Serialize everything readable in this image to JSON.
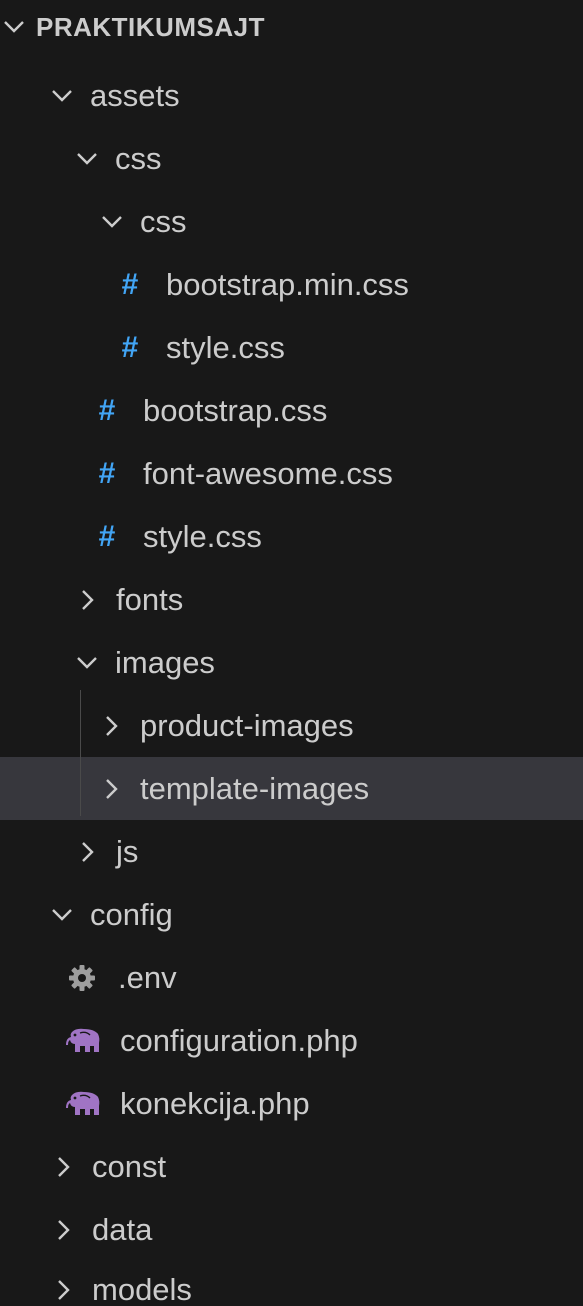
{
  "explorer": {
    "header": {
      "label": "PRAKTIKUMSAJT",
      "chevron": "chevron-down-icon"
    },
    "rows": [
      {
        "label": "assets",
        "kind": "folder",
        "expanded": true
      },
      {
        "label": "css",
        "kind": "folder",
        "expanded": true
      },
      {
        "label": "css",
        "kind": "folder",
        "expanded": true
      },
      {
        "label": "bootstrap.min.css",
        "kind": "css-file",
        "icon": "hash-icon"
      },
      {
        "label": "style.css",
        "kind": "css-file",
        "icon": "hash-icon"
      },
      {
        "label": "bootstrap.css",
        "kind": "css-file",
        "icon": "hash-icon"
      },
      {
        "label": "font-awesome.css",
        "kind": "css-file",
        "icon": "hash-icon"
      },
      {
        "label": "style.css",
        "kind": "css-file",
        "icon": "hash-icon"
      },
      {
        "label": "fonts",
        "kind": "folder",
        "expanded": false
      },
      {
        "label": "images",
        "kind": "folder",
        "expanded": true
      },
      {
        "label": "product-images",
        "kind": "folder",
        "expanded": false
      },
      {
        "label": "template-images",
        "kind": "folder",
        "expanded": false,
        "selected": true
      },
      {
        "label": "js",
        "kind": "folder",
        "expanded": false
      },
      {
        "label": "config",
        "kind": "folder",
        "expanded": true
      },
      {
        "label": ".env",
        "kind": "env-file",
        "icon": "gear-icon"
      },
      {
        "label": "configuration.php",
        "kind": "php-file",
        "icon": "php-elephant-icon"
      },
      {
        "label": "konekcija.php",
        "kind": "php-file",
        "icon": "php-elephant-icon"
      },
      {
        "label": "const",
        "kind": "folder",
        "expanded": false
      },
      {
        "label": "data",
        "kind": "folder",
        "expanded": false
      },
      {
        "label": "models",
        "kind": "folder",
        "expanded": false
      }
    ]
  },
  "colors": {
    "background": "#181818",
    "text": "#cccccc",
    "selected_row": "#37373d",
    "css_icon": "#42a5f5",
    "php_icon": "#a074c4",
    "gear_icon": "#9e9e9e"
  }
}
